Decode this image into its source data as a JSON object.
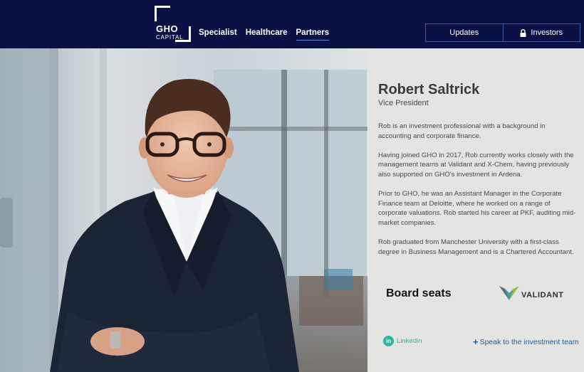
{
  "header": {
    "logo_line1": "GHO",
    "logo_line2": "CAPITAL",
    "nav": [
      "Specialist",
      "Healthcare",
      "Partners"
    ],
    "active_nav": "Partners",
    "updates_label": "Updates",
    "investors_label": "Investors"
  },
  "profile": {
    "name": "Robert Saltrick",
    "title": "Vice President",
    "bio": [
      "Rob is an investment professional with a background in accounting and corporate finance.",
      "Having joined GHO in 2017, Rob currently works closely with the management teams at Validant and X-Chem, having previously also supported on GHO's investment in Ardena.",
      "Prior to GHO, he was an Assistant Manager in the Corporate Finance team at Deloitte, where he worked on a range of corporate valuations. Rob started his career at PKF, auditing mid-market companies.",
      "Rob graduated from Manchester University with a first-class degree in Business Management and is a Chartered Accountant."
    ],
    "board_seats_label": "Board seats",
    "board_company": "VALIDANT",
    "linkedin_badge": "in",
    "linkedin_label": "Linkedin",
    "speak_label": "Speak to the investment team"
  },
  "icons": {
    "lock": "lock-icon",
    "plus": "plus-icon",
    "linkedin": "linkedin-icon",
    "validant_logo": "validant-logo"
  },
  "colors": {
    "header_bg": "#0b1145",
    "panel_bg": "#e4e4e2",
    "link_blue": "#1f5fa8",
    "linkedin_green": "#2fb59c"
  }
}
